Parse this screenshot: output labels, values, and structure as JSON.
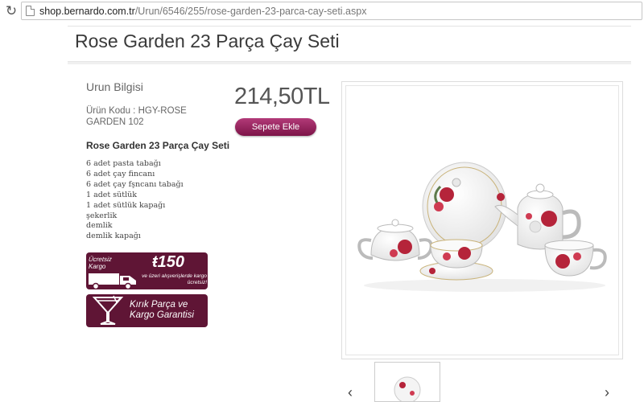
{
  "browser": {
    "url_domain": "shop.bernardo.com.tr",
    "url_path": "/Urun/6546/255/rose-garden-23-parca-cay-seti.aspx"
  },
  "product": {
    "title": "Rose Garden 23 Parça Çay Seti",
    "info_heading": "Urun Bilgisi",
    "code_text": "Ürün Kodu : HGY-ROSE GARDEN 102",
    "name": "Rose Garden 23 Parça Çay Seti",
    "contents": [
      "6 adet pasta tabağı",
      "6 adet çay fincanı",
      "6 adet çay fşncanı tabağı",
      "1 adet sütlük",
      "1 adet sütlük kapağı",
      "şekerlik",
      "demlik",
      "demlik kapağı"
    ],
    "price": "214,50TL",
    "add_to_cart_label": "Sepete Ekle"
  },
  "banners": {
    "free_shipping": {
      "line1": "Ücretsiz",
      "line2": "Kargo",
      "amount": "ŧ150",
      "sub": "ve üzeri alışverişlerde kargo ücretsiz!"
    },
    "guarantee": {
      "text_line1": "Kırık Parça ve",
      "text_line2": "Kargo Garantisi"
    }
  },
  "gallery": {
    "prev_arrow": "‹",
    "next_arrow": "›"
  },
  "colors": {
    "brand": "#7d1448",
    "banner_bg": "#5f1535"
  }
}
